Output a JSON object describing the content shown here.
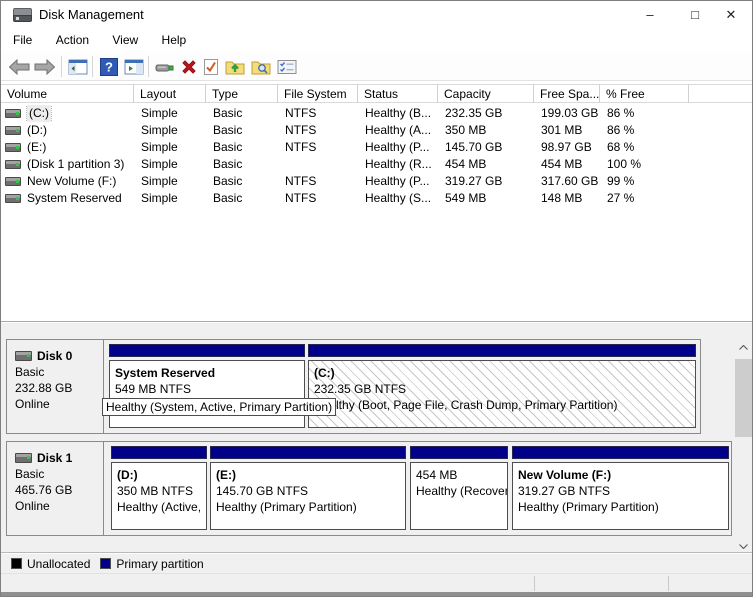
{
  "window": {
    "title": "Disk Management",
    "controls": {
      "minimize": "–",
      "maximize": "□",
      "close": "✕"
    }
  },
  "menu": {
    "items": [
      "File",
      "Action",
      "View",
      "Help"
    ]
  },
  "toolbar": {
    "icons": [
      "back",
      "forward",
      "show-console-tree",
      "help",
      "show-action-pane",
      "device",
      "delete-volume",
      "mark-partition",
      "open",
      "explore",
      "properties"
    ]
  },
  "volume_list": {
    "columns": [
      "Volume",
      "Layout",
      "Type",
      "File System",
      "Status",
      "Capacity",
      "Free Spa...",
      "% Free"
    ],
    "rows": [
      {
        "volume": "(C:)",
        "layout": "Simple",
        "type": "Basic",
        "fs": "NTFS",
        "status": "Healthy (B...",
        "capacity": "232.35 GB",
        "free": "199.03 GB",
        "pct": "86 %"
      },
      {
        "volume": "(D:)",
        "layout": "Simple",
        "type": "Basic",
        "fs": "NTFS",
        "status": "Healthy (A...",
        "capacity": "350 MB",
        "free": "301 MB",
        "pct": "86 %"
      },
      {
        "volume": "(E:)",
        "layout": "Simple",
        "type": "Basic",
        "fs": "NTFS",
        "status": "Healthy (P...",
        "capacity": "145.70 GB",
        "free": "98.97 GB",
        "pct": "68 %"
      },
      {
        "volume": "(Disk 1 partition 3)",
        "layout": "Simple",
        "type": "Basic",
        "fs": "",
        "status": "Healthy (R...",
        "capacity": "454 MB",
        "free": "454 MB",
        "pct": "100 %"
      },
      {
        "volume": "New Volume (F:)",
        "layout": "Simple",
        "type": "Basic",
        "fs": "NTFS",
        "status": "Healthy (P...",
        "capacity": "319.27 GB",
        "free": "317.60 GB",
        "pct": "99 %"
      },
      {
        "volume": "System Reserved",
        "layout": "Simple",
        "type": "Basic",
        "fs": "NTFS",
        "status": "Healthy (S...",
        "capacity": "549 MB",
        "free": "148 MB",
        "pct": "27 %"
      }
    ]
  },
  "disks": [
    {
      "name": "Disk 0",
      "kind": "Basic",
      "size": "232.88 GB",
      "state": "Online",
      "tooltip": "Healthy (System, Active, Primary Partition)",
      "partitions": [
        {
          "name": "System Reserved",
          "info": "549 MB NTFS",
          "status": ""
        },
        {
          "name": "(C:)",
          "info": "232.35 GB NTFS",
          "status": "Healthy (Boot, Page File, Crash Dump, Primary Partition)"
        }
      ]
    },
    {
      "name": "Disk 1",
      "kind": "Basic",
      "size": "465.76 GB",
      "state": "Online",
      "partitions": [
        {
          "name": "(D:)",
          "info": "350 MB NTFS",
          "status": "Healthy (Active,"
        },
        {
          "name": "(E:)",
          "info": "145.70 GB NTFS",
          "status": "Healthy (Primary Partition)"
        },
        {
          "name": "",
          "info": "454 MB",
          "status": "Healthy (Recover"
        },
        {
          "name": "New Volume  (F:)",
          "info": "319.27 GB NTFS",
          "status": "Healthy (Primary Partition)"
        }
      ]
    }
  ],
  "legend": {
    "items": [
      {
        "label": "Unallocated",
        "color": "#000000"
      },
      {
        "label": "Primary partition",
        "color": "#00008b"
      }
    ]
  },
  "colors": {
    "partition_header": "#00008b",
    "selection_hatch": "#c6c6c6"
  }
}
